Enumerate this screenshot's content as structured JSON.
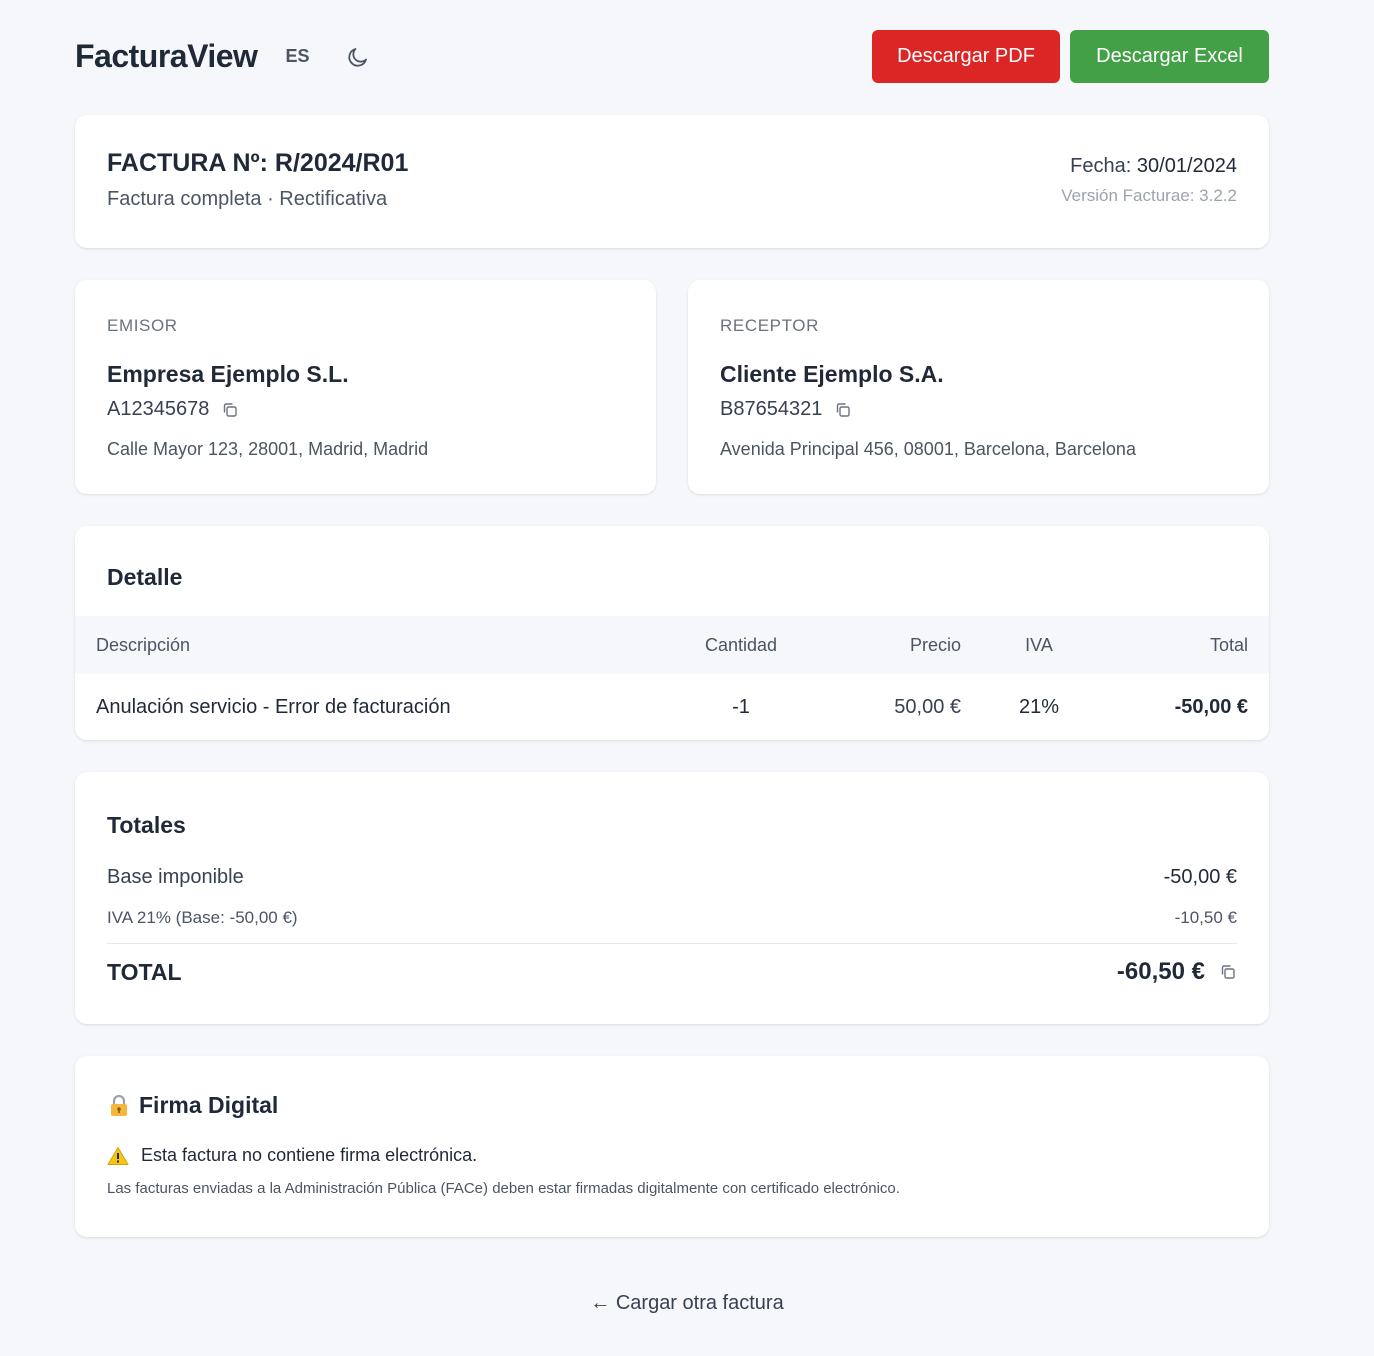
{
  "header": {
    "brand": "FacturaView",
    "language": "ES",
    "theme_icon": "moon-icon",
    "pdf_button": "Descargar PDF",
    "excel_button": "Descargar Excel",
    "pdf_color": "#dc2626",
    "excel_color": "#43a047"
  },
  "invoice": {
    "number_label": "FACTURA Nº:",
    "number": "R/2024/R01",
    "type": "Factura completa · Rectificativa",
    "date_label": "Fecha:",
    "date": "30/01/2024",
    "version": "Versión Facturae: 3.2.2"
  },
  "emisor": {
    "label": "EMISOR",
    "name": "Empresa Ejemplo S.L.",
    "tax_id": "A12345678",
    "address": "Calle Mayor 123, 28001, Madrid, Madrid"
  },
  "receptor": {
    "label": "RECEPTOR",
    "name": "Cliente Ejemplo S.A.",
    "tax_id": "B87654321",
    "address": "Avenida Principal 456, 08001, Barcelona, Barcelona"
  },
  "detail": {
    "title": "Detalle",
    "columns": {
      "description": "Descripción",
      "quantity": "Cantidad",
      "price": "Precio",
      "vat": "IVA",
      "total": "Total"
    },
    "rows": [
      {
        "description": "Anulación servicio - Error de facturación",
        "quantity": "-1",
        "price": "50,00 €",
        "vat": "21%",
        "total": "-50,00 €"
      }
    ]
  },
  "totals": {
    "title": "Totales",
    "base_label": "Base imponible",
    "base_value": "-50,00 €",
    "vat_label": "IVA 21% (Base: -50,00 €)",
    "vat_value": "-10,50 €",
    "total_label": "TOTAL",
    "total_value": "-60,50 €"
  },
  "signature": {
    "title": "Firma Digital",
    "warning": "Esta factura no contiene firma electrónica.",
    "note": "Las facturas enviadas a la Administración Pública (FACe) deben estar firmadas digitalmente con certificado electrónico."
  },
  "footer": {
    "back_link": "← Cargar otra factura"
  }
}
